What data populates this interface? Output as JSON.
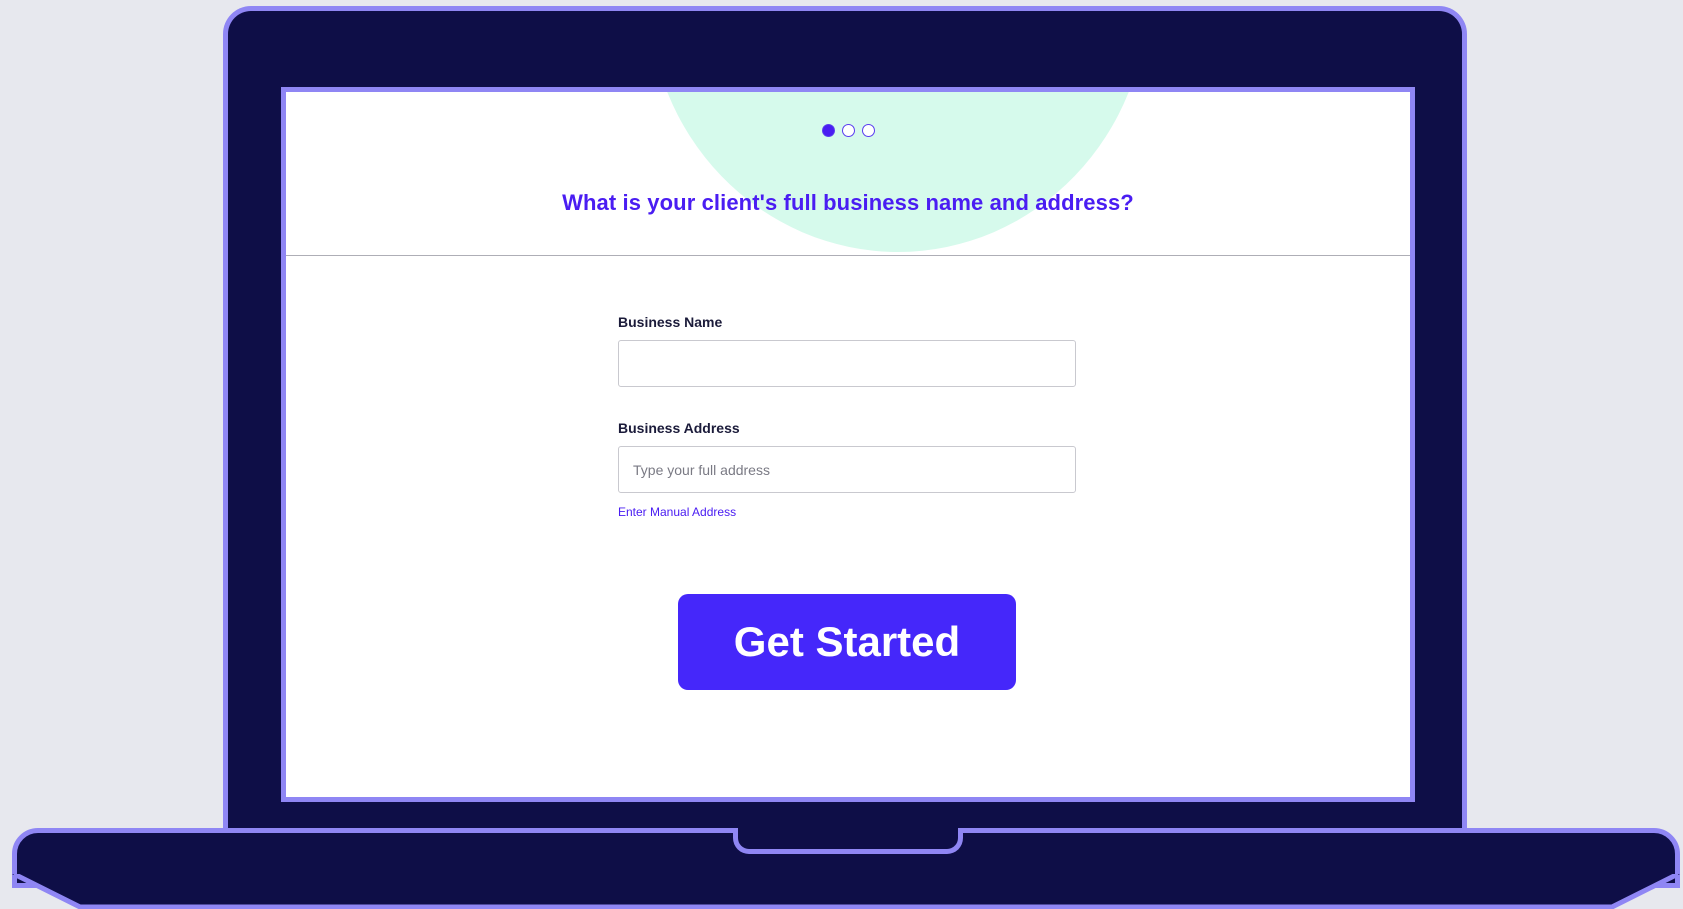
{
  "progress": {
    "total_steps": 3,
    "current_step": 1
  },
  "question": {
    "text": "What is your client's full business name and address?"
  },
  "form": {
    "business_name": {
      "label": "Business Name",
      "value": "",
      "placeholder": ""
    },
    "business_address": {
      "label": "Business Address",
      "value": "",
      "placeholder": "Type your full address"
    },
    "manual_address_link": "Enter Manual Address"
  },
  "cta": {
    "label": "Get Started"
  },
  "colors": {
    "accent": "#4a1df2",
    "button": "#4527fa",
    "device_body": "#0e0e47",
    "device_outline": "#8f86f4",
    "blob": "#d6faec",
    "background": "#e7e8ee"
  }
}
